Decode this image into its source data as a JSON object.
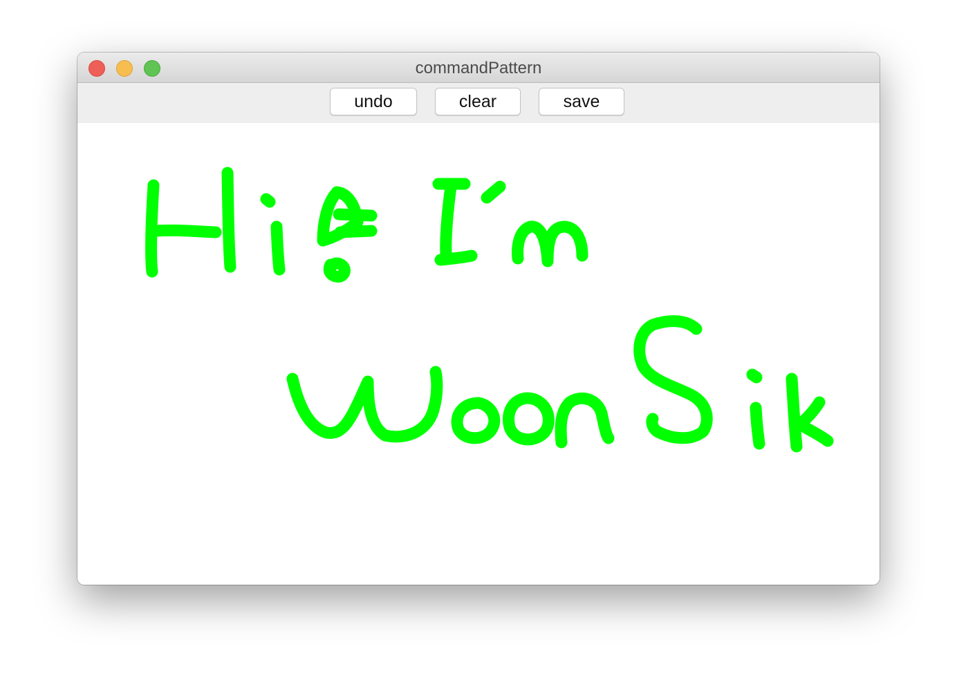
{
  "window": {
    "title": "commandPattern"
  },
  "toolbar": {
    "undo_label": "undo",
    "clear_label": "clear",
    "save_label": "save"
  },
  "canvas": {
    "stroke_color": "#00ff00",
    "background_color": "#ffffff",
    "drawing_text": "Hi! I'm WoonSik"
  },
  "colors": {
    "close": "#ee5f57",
    "minimize": "#f6be4f",
    "zoom": "#5fc453"
  }
}
